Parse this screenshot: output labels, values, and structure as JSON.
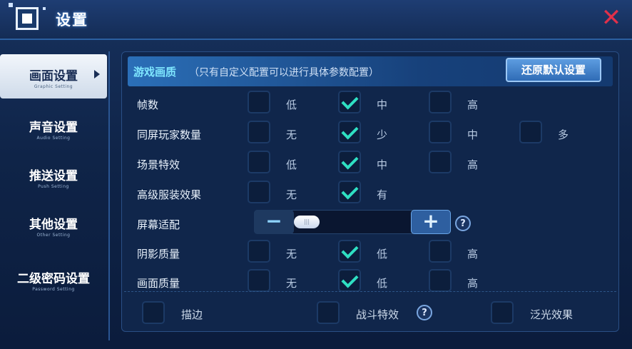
{
  "window": {
    "title": "设置"
  },
  "sidebar": {
    "items": [
      {
        "label": "画面设置",
        "sub": "Graphic Setting",
        "active": true
      },
      {
        "label": "声音设置",
        "sub": "Audio Setting",
        "active": false
      },
      {
        "label": "推送设置",
        "sub": "Push Setting",
        "active": false
      },
      {
        "label": "其他设置",
        "sub": "Other Setting",
        "active": false
      },
      {
        "label": "二级密码设置",
        "sub": "Password Setting",
        "active": false
      }
    ]
  },
  "panel": {
    "title": "游戏画质",
    "note": "（只有自定义配置可以进行具体参数配置）",
    "restore_label": "还原默认设置"
  },
  "rows": [
    {
      "label": "帧数",
      "options": [
        {
          "label": "低",
          "checked": false
        },
        {
          "label": "中",
          "checked": true
        },
        {
          "label": "高",
          "checked": false
        }
      ]
    },
    {
      "label": "同屏玩家数量",
      "options": [
        {
          "label": "无",
          "checked": false
        },
        {
          "label": "少",
          "checked": true
        },
        {
          "label": "中",
          "checked": false
        },
        {
          "label": "多",
          "checked": false
        }
      ]
    },
    {
      "label": "场景特效",
      "options": [
        {
          "label": "低",
          "checked": false
        },
        {
          "label": "中",
          "checked": true
        },
        {
          "label": "高",
          "checked": false
        }
      ]
    },
    {
      "label": "高级服装效果",
      "options": [
        {
          "label": "无",
          "checked": false
        },
        {
          "label": "有",
          "checked": true
        }
      ]
    },
    {
      "label": "阴影质量",
      "options": [
        {
          "label": "无",
          "checked": false
        },
        {
          "label": "低",
          "checked": true
        },
        {
          "label": "高",
          "checked": false
        }
      ]
    },
    {
      "label": "画面质量",
      "options": [
        {
          "label": "无",
          "checked": false
        },
        {
          "label": "低",
          "checked": true
        },
        {
          "label": "高",
          "checked": false
        }
      ]
    }
  ],
  "screen_fit": {
    "label": "屏幕适配",
    "minus": "−",
    "plus": "+",
    "help": "?",
    "handle_text": "|||"
  },
  "bottom": [
    {
      "label": "描边",
      "checked": false
    },
    {
      "label": "战斗特效",
      "checked": false,
      "help": "?"
    },
    {
      "label": "泛光效果",
      "checked": false
    }
  ],
  "colors": {
    "accent": "#2fe0c3",
    "header_text": "#7fe7ff",
    "close": "#e0304a"
  }
}
